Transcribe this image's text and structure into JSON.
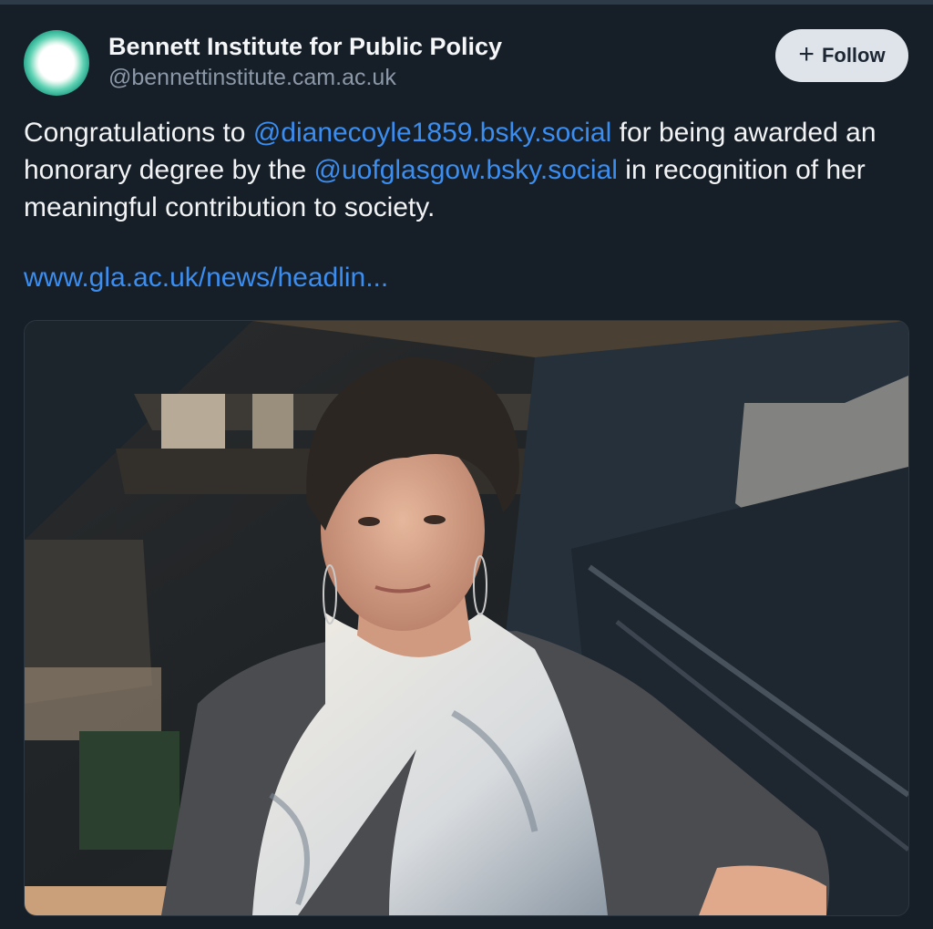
{
  "author": {
    "display_name": "Bennett Institute for Public Policy",
    "handle": "@bennettinstitute.cam.ac.uk"
  },
  "follow_button": {
    "icon": "plus-icon",
    "label": "Follow"
  },
  "post": {
    "text_part1": "Congratulations to ",
    "mention1": "@dianecoyle1859.bsky.social",
    "text_part2": " for being awarded an honorary degree by the ",
    "mention2": "@uofglasgow.bsky.social",
    "text_part3": " in recognition of her meaningful contribution to society.",
    "link": "www.gla.ac.uk/news/headlin..."
  },
  "colors": {
    "background": "#161e27",
    "mention": "#3b8ef0",
    "follow_bg": "#dfe4ea",
    "avatar_accent": "#3fc2a0"
  }
}
